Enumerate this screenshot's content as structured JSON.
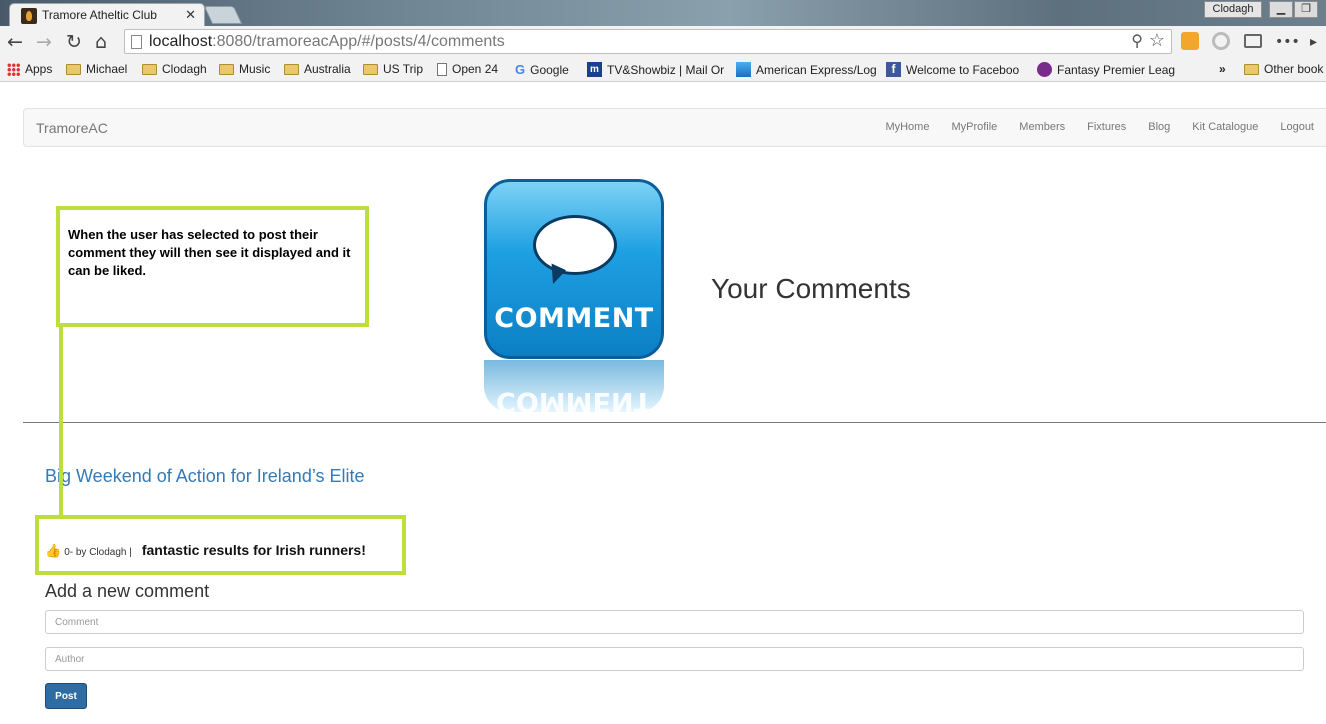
{
  "browser": {
    "tab_title": "Tramore Atheltic Club",
    "tab_close": "✕",
    "profile_name": "Clodagh",
    "url_host": "localhost",
    "url_rest": ":8080/tramoreacApp/#/posts/4/comments",
    "bookmarks": [
      {
        "label": "Apps",
        "icon": "apps-grid-icon"
      },
      {
        "label": "Michael",
        "icon": "folder-icon"
      },
      {
        "label": "Clodagh",
        "icon": "folder-icon"
      },
      {
        "label": "Music",
        "icon": "folder-icon"
      },
      {
        "label": "Australia",
        "icon": "folder-icon"
      },
      {
        "label": "US Trip",
        "icon": "folder-icon"
      },
      {
        "label": "Open 24",
        "icon": "page-icon"
      },
      {
        "label": "Google",
        "icon": "google-icon"
      },
      {
        "label": "TV&Showbiz | Mail Or",
        "icon": "mailonline-icon"
      },
      {
        "label": "American Express/Log",
        "icon": "amex-icon"
      },
      {
        "label": "Welcome to Faceboo",
        "icon": "facebook-icon"
      },
      {
        "label": "Fantasy Premier Leag",
        "icon": "premier-league-icon"
      },
      {
        "label": "»",
        "icon": "overflow-icon"
      },
      {
        "label": "Other book",
        "icon": "folder-icon"
      }
    ]
  },
  "navbar": {
    "brand": "TramoreAC",
    "links": [
      "MyHome",
      "MyProfile",
      "Members",
      "Fixtures",
      "Blog",
      "Kit Catalogue",
      "Logout"
    ]
  },
  "hero": {
    "icon_word": "COMMENT",
    "heading": "Your Comments"
  },
  "post": {
    "title": "Big Weekend of Action for Ireland’s Elite"
  },
  "comments": [
    {
      "likes": "0",
      "meta": " - by Clodagh | ",
      "text": "fantastic results for Irish runners!"
    }
  ],
  "form": {
    "heading": "Add a new comment",
    "comment_placeholder": "Comment",
    "author_placeholder": "Author",
    "submit_label": "Post"
  },
  "annotation": {
    "text": "When the user has selected to post their comment they will then see it displayed and it can be liked.",
    "color": "#bddf3c"
  }
}
